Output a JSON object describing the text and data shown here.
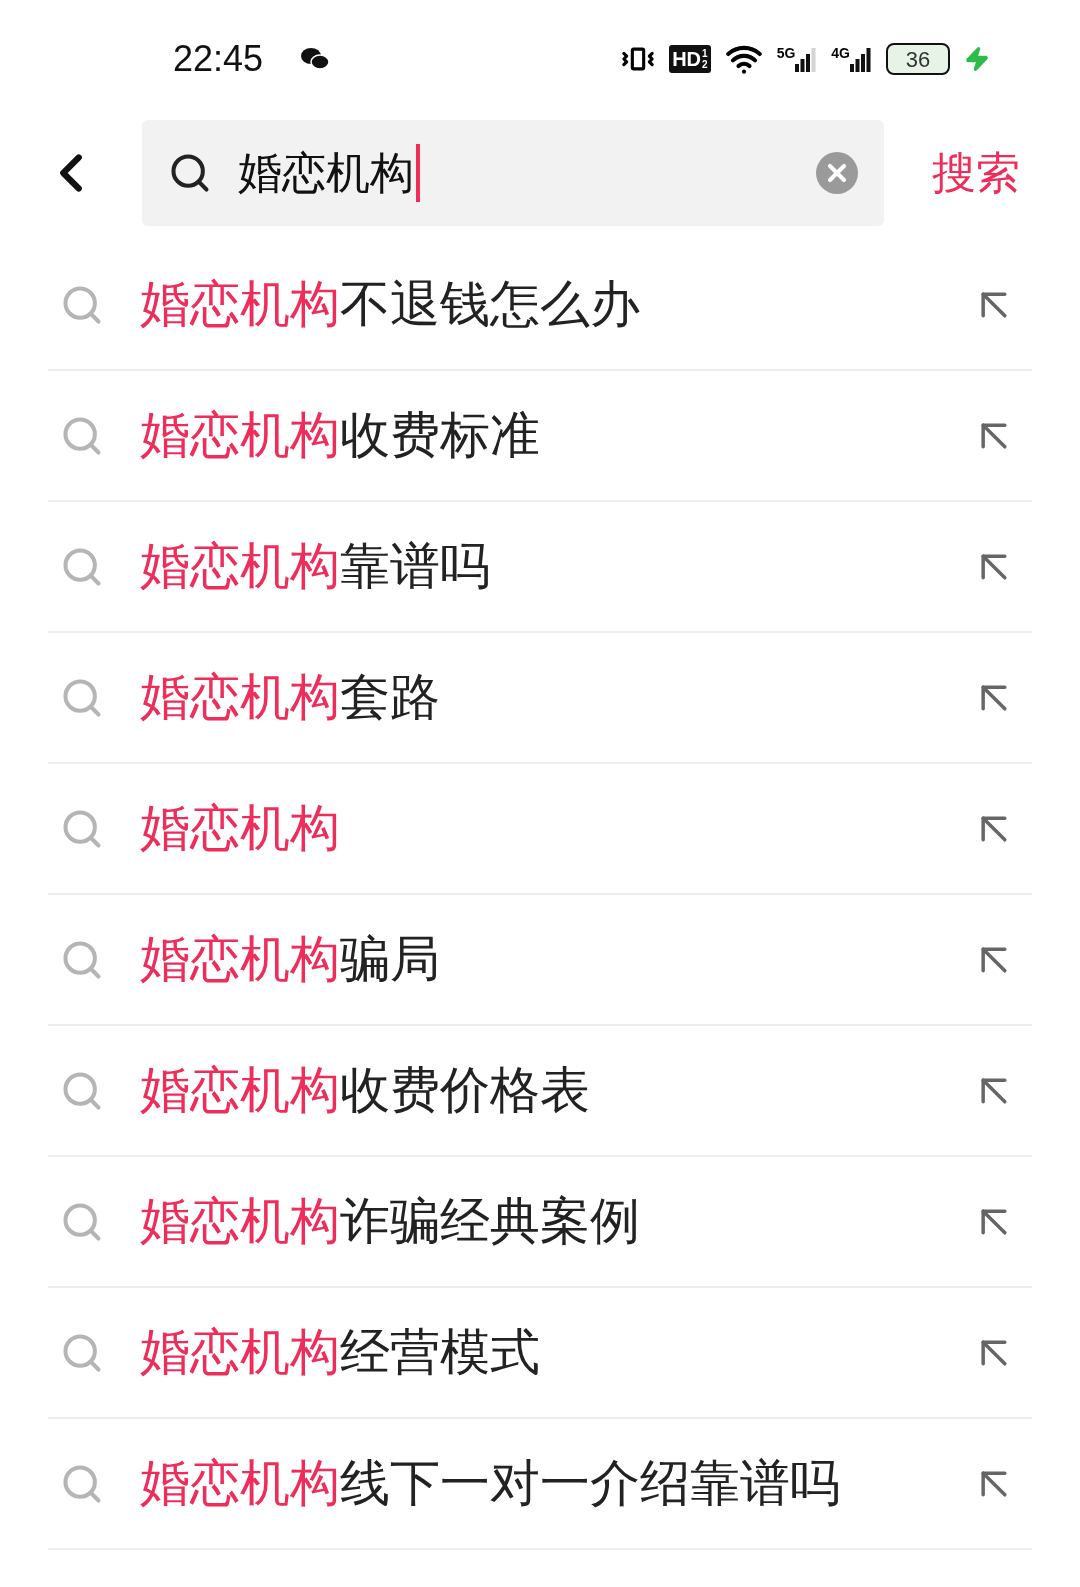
{
  "status_bar": {
    "time": "22:45",
    "hd": "HD",
    "hd_sup": "1",
    "hd_sub": "2",
    "net1": "5G",
    "net2": "4G",
    "battery": "36",
    "charging": true
  },
  "search": {
    "value": "婚恋机构",
    "clear": true,
    "submit": "搜索"
  },
  "suggestions": [
    {
      "match": "婚恋机构",
      "rest": "不退钱怎么办"
    },
    {
      "match": "婚恋机构",
      "rest": "收费标准"
    },
    {
      "match": "婚恋机构",
      "rest": "靠谱吗"
    },
    {
      "match": "婚恋机构",
      "rest": "套路"
    },
    {
      "match": "婚恋机构"
    },
    {
      "match": "婚恋机构",
      "rest": "骗局"
    },
    {
      "match": "婚恋机构",
      "rest": "收费价格表"
    },
    {
      "match": "婚恋机构",
      "rest": "诈骗经典案例"
    },
    {
      "match": "婚恋机构",
      "rest": "经营模式"
    },
    {
      "match": "婚恋机构",
      "rest": "线下一对一介绍靠谱吗"
    }
  ]
}
